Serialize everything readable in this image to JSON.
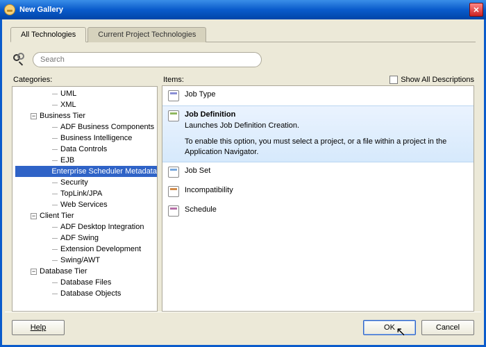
{
  "window": {
    "title": "New Gallery"
  },
  "tabs": [
    {
      "label": "All Technologies",
      "active": true
    },
    {
      "label": "Current Project Technologies",
      "active": false
    }
  ],
  "search": {
    "placeholder": "Search"
  },
  "panes": {
    "categories_label": "Categories:",
    "items_label": "Items:",
    "show_all_label": "Show All Descriptions"
  },
  "categories": [
    {
      "label": "UML",
      "depth": 2,
      "leaf": true
    },
    {
      "label": "XML",
      "depth": 2,
      "leaf": true
    },
    {
      "label": "Business Tier",
      "depth": 1,
      "expanded": true
    },
    {
      "label": "ADF Business Components",
      "depth": 2,
      "leaf": true
    },
    {
      "label": "Business Intelligence",
      "depth": 2,
      "leaf": true
    },
    {
      "label": "Data Controls",
      "depth": 2,
      "leaf": true
    },
    {
      "label": "EJB",
      "depth": 2,
      "leaf": true
    },
    {
      "label": "Enterprise Scheduler Metadata",
      "depth": 2,
      "leaf": true,
      "selected": true
    },
    {
      "label": "Security",
      "depth": 2,
      "leaf": true
    },
    {
      "label": "TopLink/JPA",
      "depth": 2,
      "leaf": true
    },
    {
      "label": "Web Services",
      "depth": 2,
      "leaf": true
    },
    {
      "label": "Client Tier",
      "depth": 1,
      "expanded": true
    },
    {
      "label": "ADF Desktop Integration",
      "depth": 2,
      "leaf": true
    },
    {
      "label": "ADF Swing",
      "depth": 2,
      "leaf": true
    },
    {
      "label": "Extension Development",
      "depth": 2,
      "leaf": true
    },
    {
      "label": "Swing/AWT",
      "depth": 2,
      "leaf": true
    },
    {
      "label": "Database Tier",
      "depth": 1,
      "expanded": true
    },
    {
      "label": "Database Files",
      "depth": 2,
      "leaf": true
    },
    {
      "label": "Database Objects",
      "depth": 2,
      "leaf": true
    }
  ],
  "items": [
    {
      "label": "Job Type",
      "selected": false
    },
    {
      "label": "Job Definition",
      "selected": true,
      "desc": "Launches Job Definition Creation.",
      "hint": "To enable this option, you must select a project, or a file within a project in the Application Navigator."
    },
    {
      "label": "Job Set",
      "selected": false
    },
    {
      "label": "Incompatibility",
      "selected": false
    },
    {
      "label": "Schedule",
      "selected": false
    }
  ],
  "footer": {
    "help": "Help",
    "ok": "OK",
    "cancel": "Cancel"
  }
}
